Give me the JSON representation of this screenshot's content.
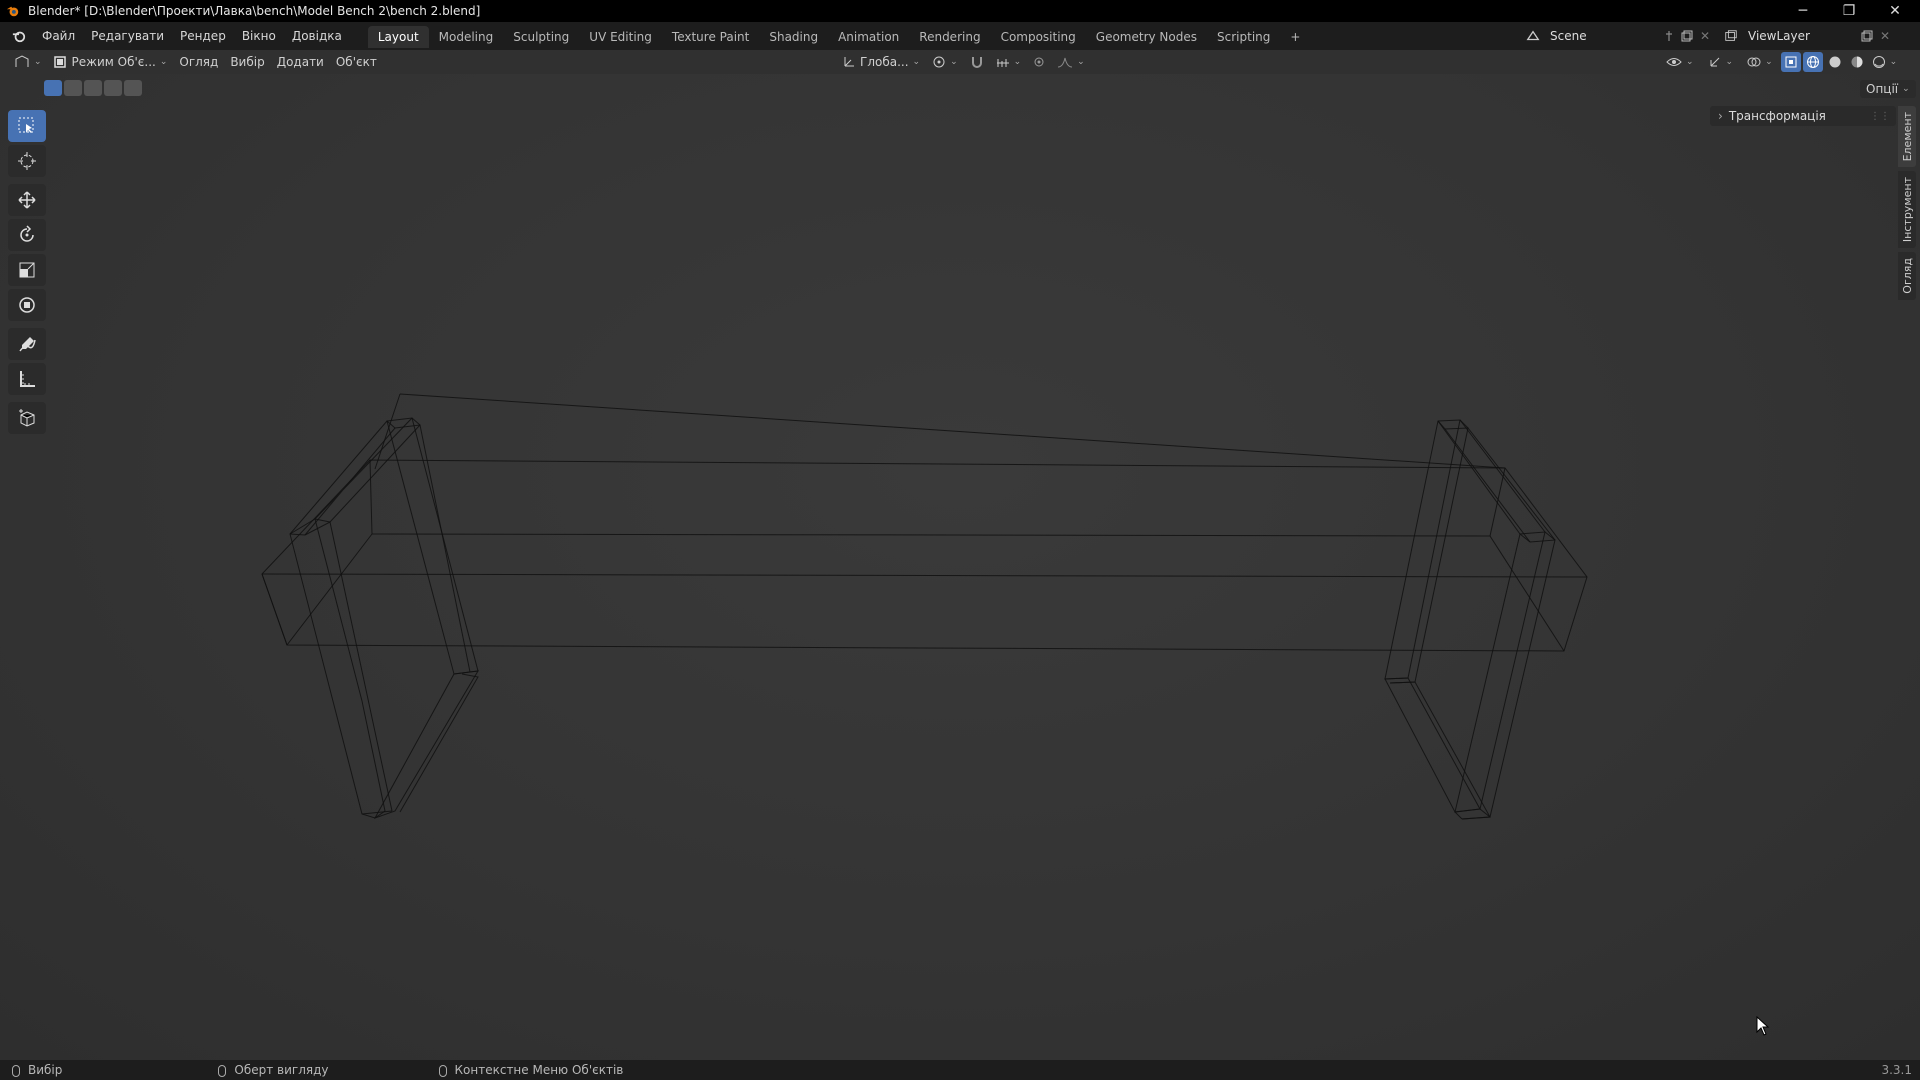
{
  "window": {
    "title": "Blender* [D:\\Blender\\Проекти\\Лавка\\bench\\Model Bench 2\\bench 2.blend]",
    "minimize": "─",
    "maximize": "❐",
    "close": "✕"
  },
  "menu": [
    "Файл",
    "Редагувати",
    "Рендер",
    "Вікно",
    "Довідка"
  ],
  "workspaces": [
    "Layout",
    "Modeling",
    "Sculpting",
    "UV Editing",
    "Texture Paint",
    "Shading",
    "Animation",
    "Rendering",
    "Compositing",
    "Geometry Nodes",
    "Scripting"
  ],
  "add_workspace": "+",
  "scene": {
    "name": "Scene"
  },
  "view_layer": {
    "name": "ViewLayer"
  },
  "header": {
    "mode": "Режим Об'є...",
    "view": "Огляд",
    "select": "Вибір",
    "add": "Додати",
    "object": "Об'єкт",
    "orientation": "Глоба..."
  },
  "options_label": "Опції",
  "npanel": {
    "transform_label": "Трансформація"
  },
  "side_tabs": [
    "Елемент",
    "Інструмент",
    "Огляд"
  ],
  "status": {
    "select": "Вибір",
    "rotate_view": "Оберт вигляду",
    "context_menu": "Контекстне Меню Об'єктів",
    "version": "3.3.1"
  },
  "colors": {
    "accent": "#4772b3",
    "bg": "#303030",
    "topbar": "#1d1d1d"
  }
}
